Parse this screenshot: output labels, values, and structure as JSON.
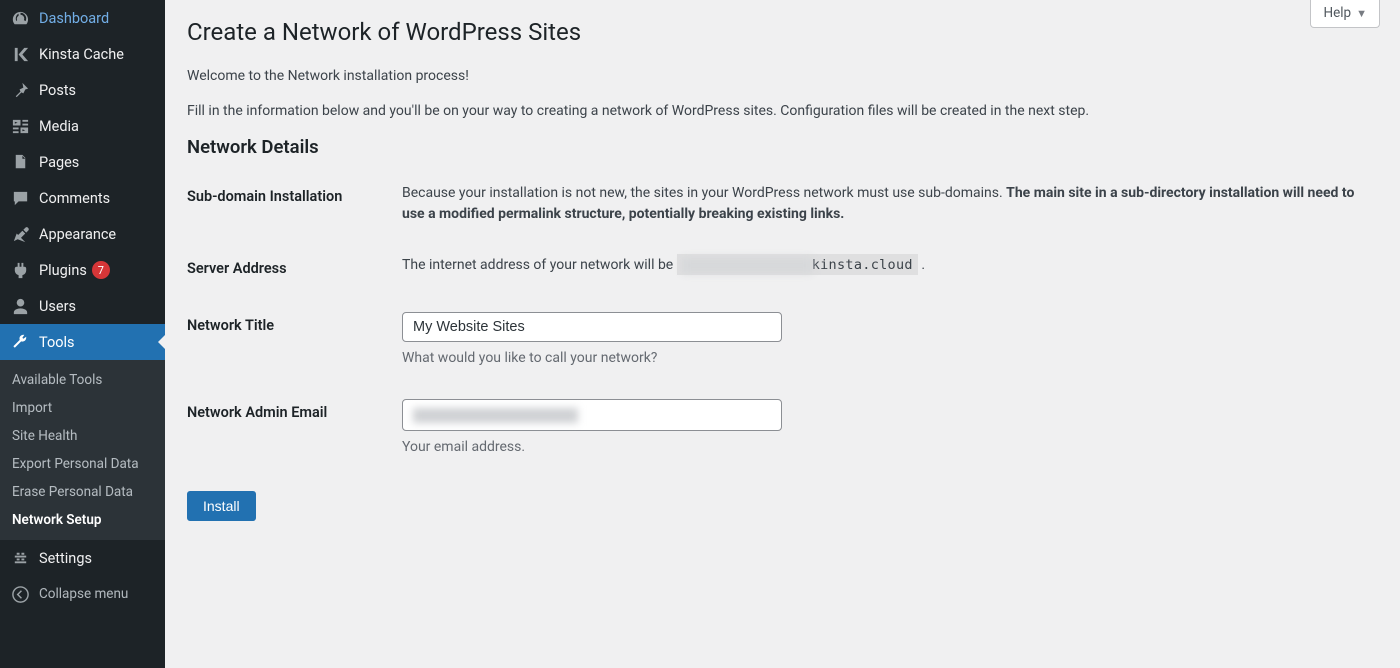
{
  "sidebar": {
    "items": [
      {
        "label": "Dashboard",
        "icon": "dashboard"
      },
      {
        "label": "Kinsta Cache",
        "icon": "kinsta"
      },
      {
        "label": "Posts",
        "icon": "pin"
      },
      {
        "label": "Media",
        "icon": "media"
      },
      {
        "label": "Pages",
        "icon": "pages"
      },
      {
        "label": "Comments",
        "icon": "comments"
      },
      {
        "label": "Appearance",
        "icon": "appearance"
      },
      {
        "label": "Plugins",
        "icon": "plugins",
        "badge": "7"
      },
      {
        "label": "Users",
        "icon": "users"
      },
      {
        "label": "Tools",
        "icon": "tools",
        "current": true
      },
      {
        "label": "Settings",
        "icon": "settings"
      }
    ],
    "submenu": [
      "Available Tools",
      "Import",
      "Site Health",
      "Export Personal Data",
      "Erase Personal Data",
      "Network Setup"
    ],
    "collapse": "Collapse menu"
  },
  "help_label": "Help",
  "page": {
    "title": "Create a Network of WordPress Sites",
    "intro1": "Welcome to the Network installation process!",
    "intro2": "Fill in the information below and you'll be on your way to creating a network of WordPress sites. Configuration files will be created in the next step.",
    "section_heading": "Network Details",
    "rows": {
      "subdomain": {
        "label": "Sub-domain Installation",
        "text_pre": "Because your installation is not new, the sites in your WordPress network must use sub-domains. ",
        "text_bold": "The main site in a sub-directory installation will need to use a modified permalink structure, potentially breaking existing links."
      },
      "server": {
        "label": "Server Address",
        "text_pre": "The internet address of your network will be ",
        "domain_suffix": "kinsta.cloud",
        "text_post": " ."
      },
      "title": {
        "label": "Network Title",
        "value": "My Website Sites",
        "help": "What would you like to call your network?"
      },
      "email": {
        "label": "Network Admin Email",
        "help": "Your email address."
      }
    },
    "submit": "Install"
  }
}
